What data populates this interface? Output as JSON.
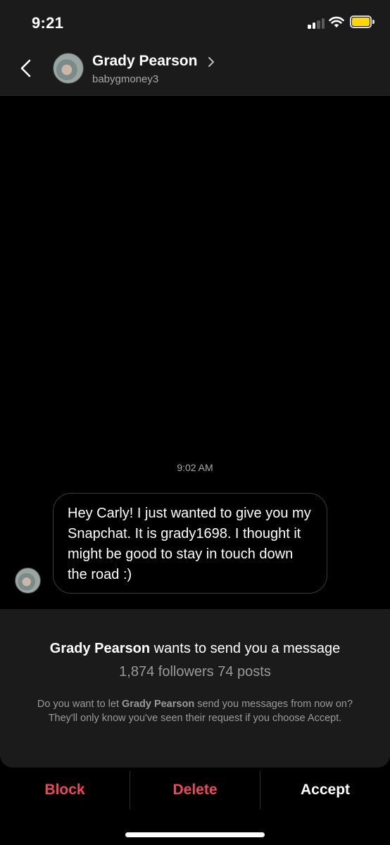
{
  "status_bar": {
    "time": "9:21",
    "signal_icon": "cellular-signal-icon",
    "wifi_icon": "wifi-icon",
    "battery_icon": "battery-icon",
    "battery_color": "#ffd60a"
  },
  "header": {
    "back_icon": "chevron-left-icon",
    "name": "Grady Pearson",
    "username": "babygmoney3",
    "chevron_icon": "chevron-right-icon"
  },
  "conversation": {
    "timestamp": "9:02 AM",
    "messages": [
      {
        "text": "Hey Carly! I just wanted to give you my Snapchat. It is grady1698. I thought it might be good to stay in touch down the road :)"
      }
    ]
  },
  "request": {
    "sender_name": "Grady Pearson",
    "title_suffix": " wants to send you a message",
    "stats": "1,874 followers 74 posts",
    "note_prefix": "Do you want to let ",
    "note_name": "Grady Pearson",
    "note_suffix": " send you messages from now on? They'll only know you've seen their request if you choose Accept."
  },
  "actions": {
    "block": "Block",
    "delete": "Delete",
    "accept": "Accept",
    "destructive_color": "#ed4956"
  }
}
